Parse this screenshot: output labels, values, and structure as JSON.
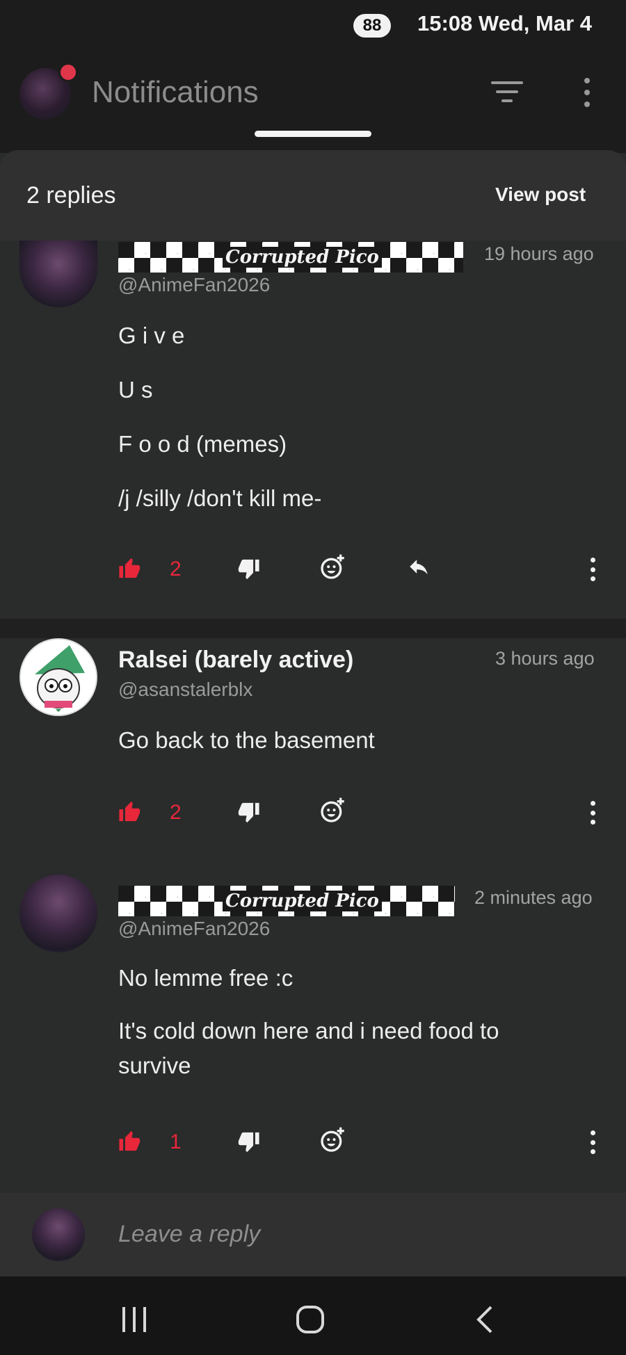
{
  "status_bar": {
    "battery": "88",
    "clock": "15:08 Wed, Mar 4"
  },
  "app_bar": {
    "title": "Notifications"
  },
  "sheet": {
    "replies_count": "2 replies",
    "view_post_label": "View post"
  },
  "comments": [
    {
      "display_name": "Corrupted Pico",
      "handle": "@AnimeFan2026",
      "time": "19 hours ago",
      "lines": [
        "G i v e",
        "U s",
        "F o o d (memes)",
        "/j /silly /don't kill me-"
      ],
      "likes": "2",
      "liked": true
    },
    {
      "display_name": "Ralsei (barely active)",
      "handle": "@asanstalerblx",
      "time": "3 hours ago",
      "lines": [
        "Go back to the basement"
      ],
      "likes": "2",
      "liked": true
    },
    {
      "display_name": "Corrupted Pico",
      "handle": "@AnimeFan2026",
      "time": "2 minutes ago",
      "lines": [
        "No lemme free :c",
        "It's cold down here and i need food to survive"
      ],
      "likes": "1",
      "liked": true
    }
  ],
  "reply_bar": {
    "placeholder": "Leave a reply"
  },
  "colors": {
    "like_active": "#e8273b",
    "background": "#2a2b2b",
    "app_bar": "#1c1c1c"
  }
}
